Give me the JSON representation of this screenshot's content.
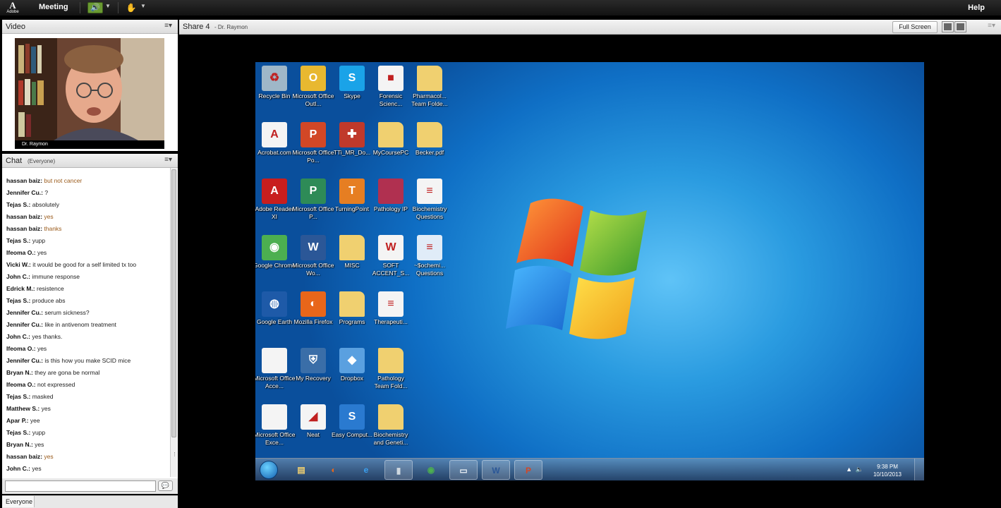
{
  "app": {
    "brand": "Adobe",
    "menu_meeting": "Meeting",
    "help": "Help"
  },
  "video_pod": {
    "title": "Video",
    "menu": "≡▾",
    "participant_name": "Dr. Raymon"
  },
  "chat_pod": {
    "title": "Chat",
    "scope": "(Everyone)",
    "menu": "≡▾",
    "messages": [
      {
        "sender": "hassan baiz",
        "text": "but not cancer",
        "color": "#9a5a1a"
      },
      {
        "sender": "Jennifer Cu.",
        "text": "?",
        "color": "#222"
      },
      {
        "sender": "Tejas S.",
        "text": "absolutely",
        "color": "#222"
      },
      {
        "sender": "hassan baiz",
        "text": "yes",
        "color": "#9a5a1a"
      },
      {
        "sender": "hassan baiz",
        "text": "thanks",
        "color": "#9a5a1a"
      },
      {
        "sender": "Tejas S.",
        "text": "yupp",
        "color": "#222"
      },
      {
        "sender": "Ifeoma O.",
        "text": "yes",
        "color": "#222"
      },
      {
        "sender": "Vicki W.",
        "text": "it would be good for a self limited tx too",
        "color": "#222"
      },
      {
        "sender": "John C.",
        "text": "immune response",
        "color": "#222"
      },
      {
        "sender": "Edrick M.",
        "text": "resistence",
        "color": "#222"
      },
      {
        "sender": "Tejas S.",
        "text": "produce abs",
        "color": "#222"
      },
      {
        "sender": "Jennifer Cu.",
        "text": "serum sickness?",
        "color": "#222"
      },
      {
        "sender": "Jennifer Cu.",
        "text": "like in antivenom treatment",
        "color": "#222"
      },
      {
        "sender": "John C.",
        "text": "yes thanks.",
        "color": "#222"
      },
      {
        "sender": "Ifeoma O.",
        "text": "yes",
        "color": "#222"
      },
      {
        "sender": "Jennifer Cu.",
        "text": "is this how you make SCID mice",
        "color": "#222"
      },
      {
        "sender": "Bryan N.",
        "text": "they are gona be normal",
        "color": "#222"
      },
      {
        "sender": "Ifeoma O.",
        "text": "not expressed",
        "color": "#222"
      },
      {
        "sender": "Tejas S.",
        "text": "masked",
        "color": "#222"
      },
      {
        "sender": "Matthew S.",
        "text": "yes",
        "color": "#222"
      },
      {
        "sender": "Apar P.",
        "text": "yee",
        "color": "#222"
      },
      {
        "sender": "Tejas S.",
        "text": "yupp",
        "color": "#222"
      },
      {
        "sender": "Bryan N.",
        "text": "yes",
        "color": "#222"
      },
      {
        "sender": "hassan baiz",
        "text": "yes",
        "color": "#9a5a1a"
      },
      {
        "sender": "John C.",
        "text": "yes",
        "color": "#222"
      }
    ],
    "input_value": "",
    "recipient": "Everyone"
  },
  "share_pod": {
    "title": "Share 4",
    "presenter": "- Dr. Raymon",
    "full_screen_label": "Full Screen",
    "menu": "≡▾"
  },
  "desktop_icons": [
    {
      "label": "Recycle Bin",
      "icon": "recycle-bin-icon",
      "color": "#9fb7c8",
      "glyph": "♻",
      "col": 0,
      "row": 0
    },
    {
      "label": "Microsoft Office Outl...",
      "icon": "outlook-icon",
      "color": "#e8b830",
      "glyph": "O",
      "col": 1,
      "row": 0
    },
    {
      "label": "Skype",
      "icon": "skype-icon",
      "color": "#1aa3e8",
      "glyph": "S",
      "col": 2,
      "row": 0
    },
    {
      "label": "Forensic Scienc...",
      "icon": "document-icon",
      "color": "#f4f4f4",
      "glyph": "■",
      "col": 3,
      "row": 0
    },
    {
      "label": "Pharmacol... Team Folde...",
      "icon": "folder-icon",
      "color": "#f0d070",
      "glyph": "",
      "col": 4,
      "row": 0
    },
    {
      "label": "Acrobat.com",
      "icon": "acrobat-icon",
      "color": "#f4f4f4",
      "glyph": "A",
      "col": 0,
      "row": 1
    },
    {
      "label": "Microsoft Office Po...",
      "icon": "powerpoint-icon",
      "color": "#d24726",
      "glyph": "P",
      "col": 1,
      "row": 1
    },
    {
      "label": "TTi_MR_Do...",
      "icon": "package-icon",
      "color": "#c0392b",
      "glyph": "✚",
      "col": 2,
      "row": 1
    },
    {
      "label": "MyCoursePC",
      "icon": "folder-icon",
      "color": "#f0d070",
      "glyph": "",
      "col": 3,
      "row": 1
    },
    {
      "label": "Becker.pdf",
      "icon": "folder-icon",
      "color": "#f0d070",
      "glyph": "",
      "col": 4,
      "row": 1
    },
    {
      "label": "Adobe Reader XI",
      "icon": "adobe-reader-icon",
      "color": "#c81e1e",
      "glyph": "A",
      "col": 0,
      "row": 2
    },
    {
      "label": "Microsoft Office P...",
      "icon": "publisher-icon",
      "color": "#2e8b57",
      "glyph": "P",
      "col": 1,
      "row": 2
    },
    {
      "label": "TurningPoint",
      "icon": "turningpoint-icon",
      "color": "#e67e22",
      "glyph": "T",
      "col": 2,
      "row": 2
    },
    {
      "label": "Pathology IP",
      "icon": "image-icon",
      "color": "#b03050",
      "glyph": "",
      "col": 3,
      "row": 2
    },
    {
      "label": "Biochemistry Questions",
      "icon": "document-icon",
      "color": "#f4f4f4",
      "glyph": "≡",
      "col": 4,
      "row": 2
    },
    {
      "label": "Google Chrome",
      "icon": "chrome-icon",
      "color": "#4caf50",
      "glyph": "◉",
      "col": 0,
      "row": 3
    },
    {
      "label": "Microsoft Office Wo...",
      "icon": "word-icon",
      "color": "#2b5797",
      "glyph": "W",
      "col": 1,
      "row": 3
    },
    {
      "label": "MISC",
      "icon": "folder-icon",
      "color": "#f0d070",
      "glyph": "",
      "col": 2,
      "row": 3
    },
    {
      "label": "SOFT ACCENT_S...",
      "icon": "word-doc-icon",
      "color": "#f4f4f4",
      "glyph": "W",
      "col": 3,
      "row": 3
    },
    {
      "label": "~$ochemi... Questions",
      "icon": "document-icon",
      "color": "#e0ecf8",
      "glyph": "≡",
      "col": 4,
      "row": 3
    },
    {
      "label": "Google Earth",
      "icon": "google-earth-icon",
      "color": "#1e5aa8",
      "glyph": "◍",
      "col": 0,
      "row": 4
    },
    {
      "label": "Mozilla Firefox",
      "icon": "firefox-icon",
      "color": "#e8661a",
      "glyph": "◐",
      "col": 1,
      "row": 4
    },
    {
      "label": "Programs",
      "icon": "folder-icon",
      "color": "#f0d070",
      "glyph": "",
      "col": 2,
      "row": 4
    },
    {
      "label": "Therapeuti...",
      "icon": "pdf-icon",
      "color": "#f4f4f4",
      "glyph": "≡",
      "col": 3,
      "row": 4
    },
    {
      "label": "Microsoft Office Acce...",
      "icon": "document-icon",
      "color": "#f4f4f4",
      "glyph": "",
      "col": 0,
      "row": 5
    },
    {
      "label": "My Recovery",
      "icon": "recovery-icon",
      "color": "#3a6ea8",
      "glyph": "⛨",
      "col": 1,
      "row": 5
    },
    {
      "label": "Dropbox",
      "icon": "dropbox-icon",
      "color": "#5aa0e0",
      "glyph": "◆",
      "col": 2,
      "row": 5
    },
    {
      "label": "Pathology Team Fold...",
      "icon": "folder-icon",
      "color": "#f0d070",
      "glyph": "",
      "col": 3,
      "row": 5
    },
    {
      "label": "Microsoft Office Exce...",
      "icon": "document-icon",
      "color": "#f4f4f4",
      "glyph": "",
      "col": 0,
      "row": 6
    },
    {
      "label": "Neat",
      "icon": "neat-icon",
      "color": "#f4f4f4",
      "glyph": "◢",
      "col": 1,
      "row": 6
    },
    {
      "label": "Easy Comput...",
      "icon": "easy-computing-icon",
      "color": "#2a7ad0",
      "glyph": "S",
      "col": 2,
      "row": 6
    },
    {
      "label": "Biochemistry and Geneti...",
      "icon": "folder-icon",
      "color": "#f0d070",
      "glyph": "",
      "col": 3,
      "row": 6
    }
  ],
  "taskbar": {
    "items": [
      {
        "icon": "folder-icon",
        "glyph": "▤",
        "color": "#f0d070",
        "open": false
      },
      {
        "icon": "firefox-icon",
        "glyph": "◐",
        "color": "#e8661a",
        "open": false
      },
      {
        "icon": "ie-icon",
        "glyph": "e",
        "color": "#3aa0f0",
        "open": false
      },
      {
        "icon": "connect-app-icon",
        "glyph": "▮",
        "color": "#cfd8e0",
        "open": true
      },
      {
        "icon": "chrome-icon",
        "glyph": "◉",
        "color": "#4caf50",
        "open": false
      },
      {
        "icon": "network-icon",
        "glyph": "▭",
        "color": "#e8eef4",
        "open": true
      },
      {
        "icon": "word-icon",
        "glyph": "W",
        "color": "#2b5797",
        "open": true
      },
      {
        "icon": "powerpoint-icon",
        "glyph": "P",
        "color": "#d24726",
        "open": true
      }
    ],
    "time": "9:38 PM",
    "date": "10/10/2013"
  }
}
